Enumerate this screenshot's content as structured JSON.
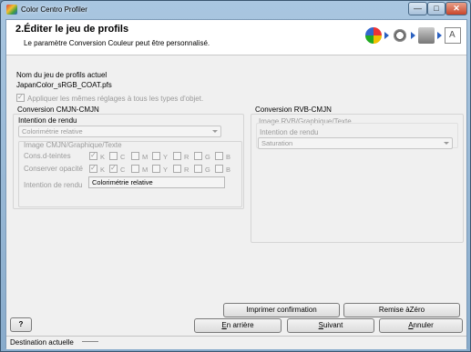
{
  "window": {
    "title": "Color Centro Profiler",
    "min_label": "—",
    "max_label": "□",
    "close_label": "✕"
  },
  "header": {
    "title": "2.Éditer le jeu de profils",
    "subtitle": "Le paramètre Conversion Couleur peut être personnalisé."
  },
  "profile": {
    "name_label": "Nom du jeu de profils actuel",
    "name_value": "JapanColor_sRGB_COAT.pfs",
    "apply_all_label": "Appliquer les mêmes réglages à tous les types d'objet.",
    "apply_all_checked": true
  },
  "cmyk": {
    "title": "Conversion CMJN-CMJN",
    "intent_label": "Intention de rendu",
    "intent_value": "Colorimétrie relative",
    "sub_title": "Image CMJN/Graphique/Texte",
    "cons_label": "Cons.d-teintes",
    "keep_label": "Conserver opacité",
    "intent2_label": "Intention de rendu",
    "intent2_value": "Colorimétrie relative",
    "channels": [
      "K",
      "C",
      "M",
      "Y",
      "R",
      "G",
      "B"
    ]
  },
  "rgb": {
    "title": "Conversion RVB-CMJN",
    "sub_title": "Image RVB/Graphique/Texte",
    "intent_label": "Intention de rendu",
    "intent_value": "Saturation"
  },
  "buttons": {
    "print_confirm": "Imprimer confirmation",
    "reset_zero": "Remise àZéro",
    "back_u": "E",
    "back_rest": "n arrière",
    "next_u": "S",
    "next_rest": "uivant",
    "cancel_u": "A",
    "cancel_rest": "nnuler",
    "help": "?"
  },
  "status": {
    "destination_label": "Destination actuelle"
  },
  "colors": {
    "accent_arrow": "#2a60c0",
    "title_bar": "#a9c6e0"
  }
}
